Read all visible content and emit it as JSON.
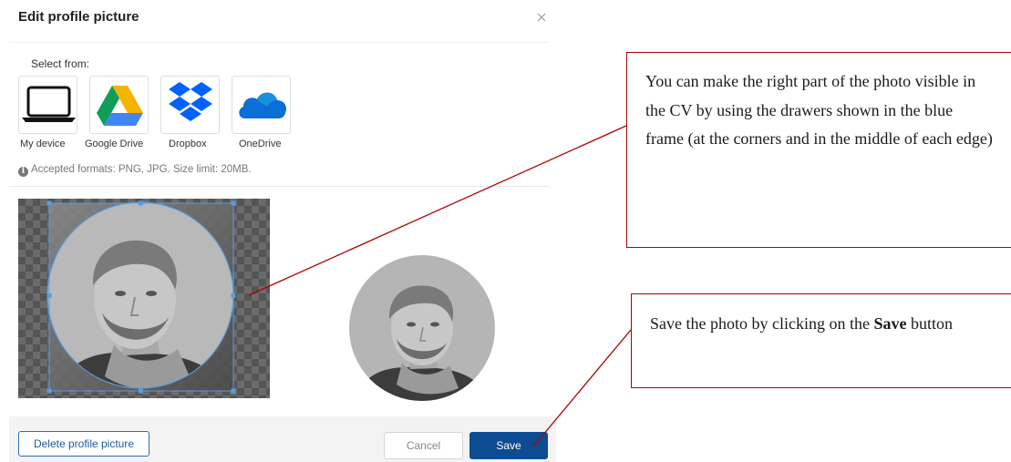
{
  "dialog": {
    "title": "Edit profile picture",
    "select_from_label": "Select from:",
    "sources": [
      {
        "label": "My device",
        "icon": "laptop-icon"
      },
      {
        "label": "Google Drive",
        "icon": "google-drive-icon"
      },
      {
        "label": "Dropbox",
        "icon": "dropbox-icon"
      },
      {
        "label": "OneDrive",
        "icon": "onedrive-icon"
      }
    ],
    "formats_note": "Accepted formats: PNG, JPG. Size limit: 20MB.",
    "buttons": {
      "delete": "Delete profile picture",
      "cancel": "Cancel",
      "save": "Save"
    }
  },
  "callouts": {
    "crop_hint": "You can make the right part of the photo visible in the CV by using the drawers shown in the blue frame (at the corners and in the middle of each edge)",
    "save_hint_prefix": "Save the photo by clicking on the ",
    "save_hint_bold": "Save",
    "save_hint_suffix": " button"
  },
  "colors": {
    "accent_blue": "#0d4c92",
    "crop_frame": "#5b9be0",
    "callout_border": "#b00000",
    "google_drive": [
      "#0f9d58",
      "#f4b400",
      "#4285f4"
    ],
    "dropbox": "#0061fe",
    "onedrive": "#0a6fd6"
  }
}
